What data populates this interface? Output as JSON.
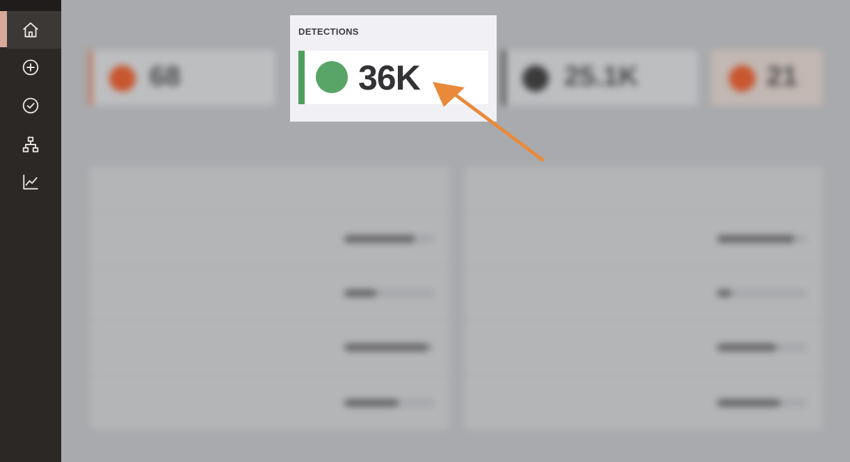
{
  "sidebar": {
    "icons": [
      "home-icon",
      "plus-circle-icon",
      "check-circle-icon",
      "hierarchy-icon",
      "chart-line-icon"
    ]
  },
  "stats": [
    {
      "title": "",
      "value": "68",
      "dot_color": "#c8562f"
    },
    {
      "title": "DETECTIONS",
      "value": "36K",
      "dot_color": "#59a567",
      "accent_color": "#4fa05d"
    },
    {
      "title": "",
      "value": "25.1K",
      "dot_color": "#3b3b3c"
    },
    {
      "title": "",
      "value": "21",
      "dot_color": "#c8562f"
    }
  ],
  "tables": [
    {
      "title": "",
      "headers": [
        "",
        "",
        ""
      ],
      "rows": [
        {
          "name": "",
          "count": "",
          "progress": 0.78
        },
        {
          "name": "",
          "count": "",
          "progress": 0.35
        },
        {
          "name": "",
          "count": "",
          "progress": 0.93
        },
        {
          "name": "",
          "count": "",
          "progress": 0.6
        }
      ]
    },
    {
      "title": "",
      "headers": [
        "",
        "",
        ""
      ],
      "rows": [
        {
          "name": "",
          "count": "",
          "progress": 0.85
        },
        {
          "name": "",
          "count": "",
          "progress": 0.15
        },
        {
          "name": "",
          "count": "",
          "progress": 0.65
        },
        {
          "name": "",
          "count": "",
          "progress": 0.7
        }
      ]
    }
  ],
  "colors": {
    "arrow": "#e88a3a",
    "sidebar": "#2b2826",
    "highlight_background": "#f0f0f5"
  }
}
